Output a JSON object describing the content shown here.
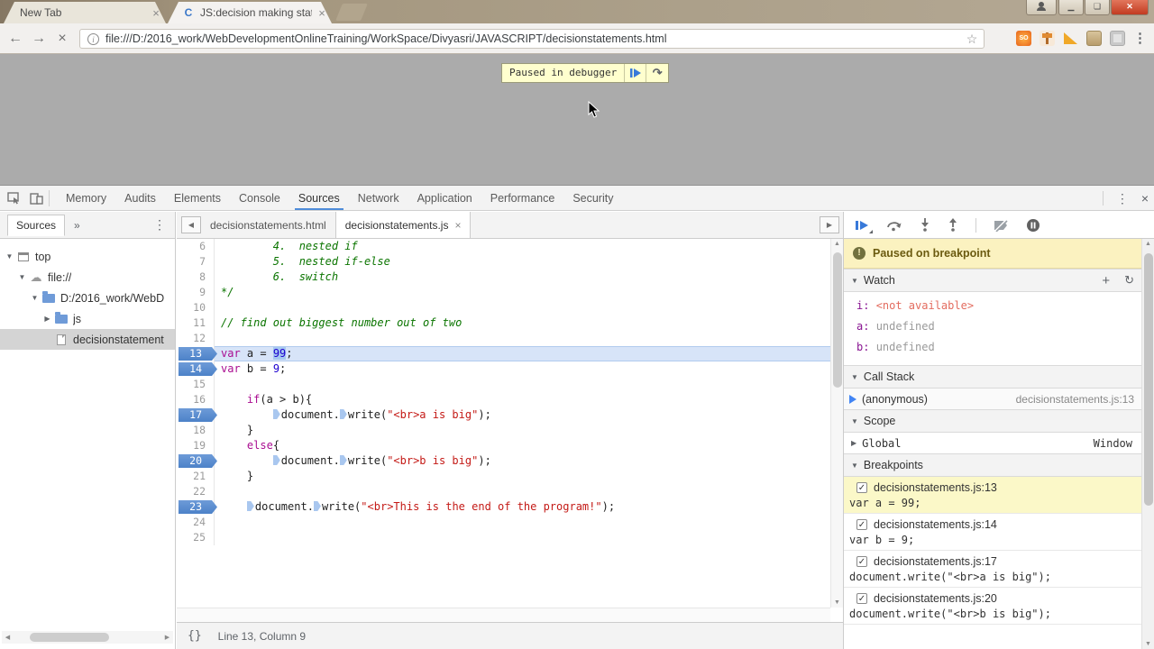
{
  "browser": {
    "tabs": [
      {
        "title": "New Tab"
      },
      {
        "title": "JS:decision making state",
        "favicon": "C"
      }
    ],
    "url": "file:///D:/2016_work/WebDevelopmentOnlineTraining/WorkSpace/Divyasri/JAVASCRIPT/decisionstatements.html",
    "colors": {
      "titlebar": "#a3957d",
      "close_button": "#c23b20",
      "accent_blue": "#4e8cd9"
    }
  },
  "icons": {
    "back": "←",
    "forward": "→",
    "stop": "×",
    "info": "i",
    "star": "☆",
    "so_ext": "SO",
    "menu_dots": "⋮",
    "tab_close": "×",
    "window_close": "✕",
    "window_min": "—",
    "chevron_double": "»",
    "more_vertical": "⋮",
    "devtools_close": "×",
    "panel_prev": "◀",
    "panel_next": "▶",
    "braces": "{}",
    "add": "+",
    "refresh": "↻",
    "tri_open": "▼",
    "tri_closed": "▶",
    "check": "✓",
    "up": "▲",
    "down": "▼",
    "left": "◀",
    "right": "▶",
    "cloud": "☁",
    "step_over": "↷"
  },
  "page": {
    "paused_banner": "Paused in debugger"
  },
  "devtools": {
    "tabs": [
      "Memory",
      "Audits",
      "Elements",
      "Console",
      "Sources",
      "Network",
      "Application",
      "Performance",
      "Security"
    ],
    "active_tab": "Sources",
    "navigator": {
      "tab_label": "Sources",
      "tree": [
        {
          "label": "top",
          "icon": "frame",
          "depth": 0,
          "disclosure": "open"
        },
        {
          "label": "file://",
          "icon": "cloud",
          "depth": 1,
          "disclosure": "open"
        },
        {
          "label": "D:/2016_work/WebD",
          "icon": "folder",
          "depth": 2,
          "disclosure": "open"
        },
        {
          "label": "js",
          "icon": "folder",
          "depth": 3,
          "disclosure": "closed"
        },
        {
          "label": "decisionstatement",
          "icon": "file",
          "depth": 3,
          "disclosure": "none",
          "selected": true
        }
      ]
    },
    "editor": {
      "tabs": [
        {
          "label": "decisionstatements.html",
          "active": false
        },
        {
          "label": "decisionstatements.js",
          "active": true,
          "closable": true
        }
      ],
      "lines": [
        {
          "n": 6,
          "segs": [
            [
              "        4.  nested if",
              "c"
            ]
          ]
        },
        {
          "n": 7,
          "segs": [
            [
              "        5.  nested if-else",
              "c"
            ]
          ]
        },
        {
          "n": 8,
          "segs": [
            [
              "        6.  switch",
              "c"
            ]
          ]
        },
        {
          "n": 9,
          "segs": [
            [
              "*/",
              "c"
            ]
          ]
        },
        {
          "n": 10,
          "segs": []
        },
        {
          "n": 11,
          "segs": [
            [
              "// find out biggest number out of two",
              "c"
            ]
          ]
        },
        {
          "n": 12,
          "segs": []
        },
        {
          "n": 13,
          "bp": true,
          "cur": true,
          "segs": [
            [
              "var",
              "k"
            ],
            [
              " a = ",
              "p"
            ],
            [
              "99",
              "n sel"
            ],
            [
              ";",
              "p"
            ]
          ]
        },
        {
          "n": 14,
          "bp": true,
          "segs": [
            [
              "var",
              "k"
            ],
            [
              " b = ",
              "p"
            ],
            [
              "9",
              "n"
            ],
            [
              ";",
              "p"
            ]
          ]
        },
        {
          "n": 15,
          "segs": []
        },
        {
          "n": 16,
          "segs": [
            [
              "    ",
              "p"
            ],
            [
              "if",
              "k"
            ],
            [
              "(a > b){",
              "p"
            ]
          ]
        },
        {
          "n": 17,
          "bp": true,
          "segs": [
            [
              "        ",
              "p"
            ],
            [
              "",
              "ibp"
            ],
            [
              "document.",
              "p"
            ],
            [
              "",
              "ibp"
            ],
            [
              "write(",
              "p"
            ],
            [
              "\"<br>a is big\"",
              "s"
            ],
            [
              ");",
              "p"
            ]
          ]
        },
        {
          "n": 18,
          "segs": [
            [
              "    }",
              "p"
            ]
          ]
        },
        {
          "n": 19,
          "segs": [
            [
              "    ",
              "p"
            ],
            [
              "else",
              "k"
            ],
            [
              "{",
              "p"
            ]
          ]
        },
        {
          "n": 20,
          "bp": true,
          "segs": [
            [
              "        ",
              "p"
            ],
            [
              "",
              "ibp"
            ],
            [
              "document.",
              "p"
            ],
            [
              "",
              "ibp"
            ],
            [
              "write(",
              "p"
            ],
            [
              "\"<br>b is big\"",
              "s"
            ],
            [
              ");",
              "p"
            ]
          ]
        },
        {
          "n": 21,
          "segs": [
            [
              "    }",
              "p"
            ]
          ]
        },
        {
          "n": 22,
          "segs": []
        },
        {
          "n": 23,
          "bp": true,
          "segs": [
            [
              "    ",
              "p"
            ],
            [
              "",
              "ibp"
            ],
            [
              "document.",
              "p"
            ],
            [
              "",
              "ibp"
            ],
            [
              "write(",
              "p"
            ],
            [
              "\"<br>This is the end of the program!\"",
              "s"
            ],
            [
              ");",
              "p"
            ]
          ]
        },
        {
          "n": 24,
          "segs": []
        },
        {
          "n": 25,
          "segs": []
        }
      ],
      "status": {
        "line_col": "Line 13, Column 9"
      }
    },
    "debugger": {
      "paused_message": "Paused on breakpoint",
      "watch": {
        "title": "Watch",
        "items": [
          {
            "name": "i",
            "value": "<not available>",
            "state": "error"
          },
          {
            "name": "a",
            "value": "undefined",
            "state": "muted"
          },
          {
            "name": "b",
            "value": "undefined",
            "state": "muted"
          }
        ]
      },
      "call_stack": {
        "title": "Call Stack",
        "frames": [
          {
            "fn": "(anonymous)",
            "location": "decisionstatements.js:13"
          }
        ]
      },
      "scope": {
        "title": "Scope",
        "entries": [
          {
            "name": "Global",
            "value": "Window"
          }
        ]
      },
      "breakpoints": {
        "title": "Breakpoints",
        "items": [
          {
            "location": "decisionstatements.js:13",
            "code": "var a = 99;",
            "checked": true,
            "highlighted": true
          },
          {
            "location": "decisionstatements.js:14",
            "code": "var b = 9;",
            "checked": true
          },
          {
            "location": "decisionstatements.js:17",
            "code": "document.write(\"<br>a is big\");",
            "checked": true
          },
          {
            "location": "decisionstatements.js:20",
            "code": "document.write(\"<br>b is big\");",
            "checked": true
          }
        ]
      }
    }
  }
}
